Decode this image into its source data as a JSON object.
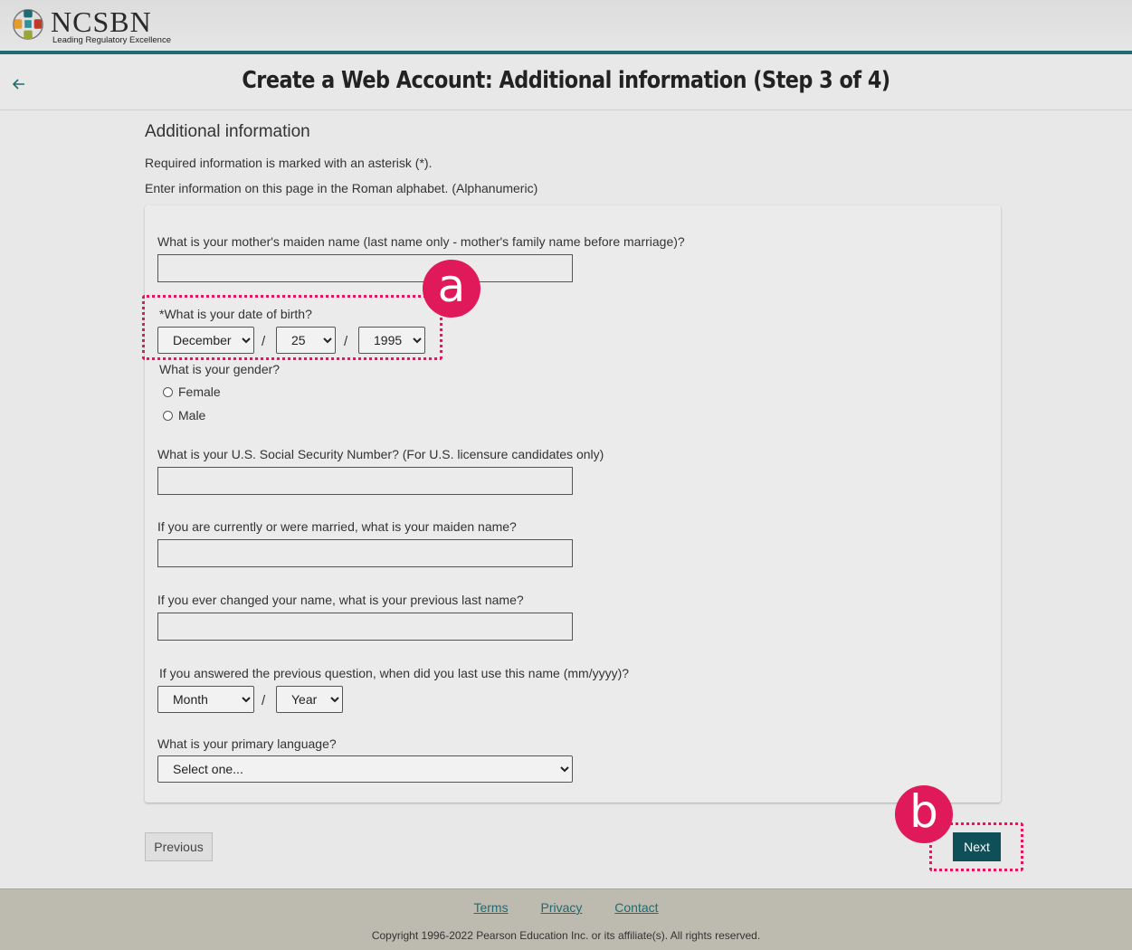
{
  "header": {
    "logo_name": "NCSBN",
    "logo_tagline": "Leading Regulatory Excellence",
    "title": "Create a Web Account: Additional information (Step 3 of 4)"
  },
  "section": {
    "title": "Additional information",
    "note_required": "Required information is marked with an asterisk (*).",
    "note_alphabet": "Enter information on this page in the Roman alphabet. (Alphanumeric)"
  },
  "form": {
    "mother_maiden_label": "What is your mother's maiden name (last name only - mother's family name before marriage)?",
    "mother_maiden_value": "",
    "dob_label": "*What is your date of birth?",
    "dob_month": "December",
    "dob_day": "25",
    "dob_year": "1995",
    "gender_label": "What is your gender?",
    "gender_female": "Female",
    "gender_male": "Male",
    "ssn_label": "What is your U.S. Social Security Number? (For U.S. licensure candidates only)",
    "ssn_value": "",
    "maiden_label": "If you are currently or were married, what is your maiden name?",
    "maiden_value": "",
    "prev_last_label": "If you ever changed your name, what is your previous last name?",
    "prev_last_value": "",
    "last_use_label": "If you answered the previous question, when did you last use this name (mm/yyyy)?",
    "last_use_month": "Month",
    "last_use_year": "Year",
    "language_label": "What is your primary language?",
    "language_value": "Select one...",
    "separator": "/"
  },
  "buttons": {
    "previous": "Previous",
    "next": "Next"
  },
  "footer": {
    "terms": "Terms",
    "privacy": "Privacy",
    "contact": "Contact",
    "copyright": "Copyright 1996-2022 Pearson Education Inc. or its affiliate(s). All rights reserved."
  },
  "annotations": {
    "a": "a",
    "b": "b",
    "color": "#e0195b"
  },
  "colors": {
    "accent": "#1f6b72",
    "next_button": "#0f4f57"
  }
}
